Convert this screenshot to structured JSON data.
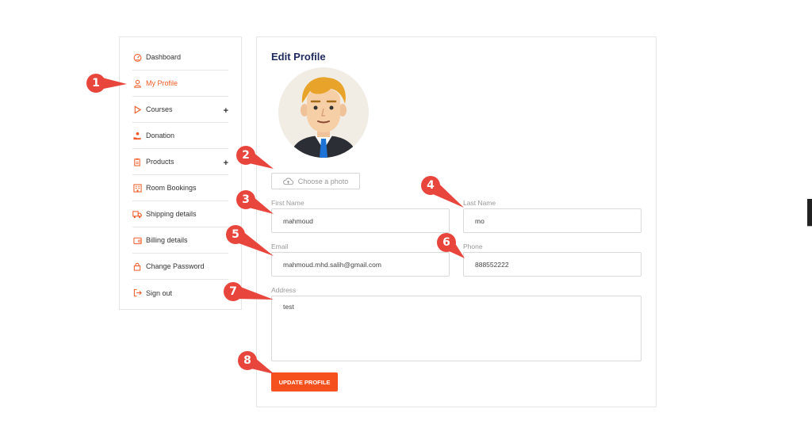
{
  "sidebar": {
    "items": [
      {
        "label": "Dashboard",
        "icon": "dashboard-icon"
      },
      {
        "label": "My Profile",
        "icon": "user-icon",
        "active": true
      },
      {
        "label": "Courses",
        "icon": "play-icon",
        "expandable": "+"
      },
      {
        "label": "Donation",
        "icon": "donation-hand-icon"
      },
      {
        "label": "Products",
        "icon": "clipboard-icon",
        "expandable": "+"
      },
      {
        "label": "Room Bookings",
        "icon": "building-icon"
      },
      {
        "label": "Shipping details",
        "icon": "truck-icon"
      },
      {
        "label": "Billing details",
        "icon": "wallet-icon"
      },
      {
        "label": "Change Password",
        "icon": "lock-icon"
      },
      {
        "label": "Sign out",
        "icon": "sign-out-icon"
      }
    ]
  },
  "profile": {
    "title": "Edit Profile",
    "photo_button": "Choose a photo",
    "fields": {
      "first_name": {
        "label": "First Name",
        "value": "mahmoud"
      },
      "last_name": {
        "label": "Last Name",
        "value": "mo"
      },
      "email": {
        "label": "Email",
        "value": "mahmoud.mhd.salih@gmail.com"
      },
      "phone": {
        "label": "Phone",
        "value": "888552222"
      },
      "address": {
        "label": "Address",
        "value": "test"
      }
    },
    "update_button": "UPDATE PROFILE"
  },
  "annotations": [
    "1",
    "2",
    "3",
    "4",
    "5",
    "6",
    "7",
    "8"
  ],
  "colors": {
    "accent": "#f15a24",
    "button": "#f4511e",
    "title": "#1f2a5c",
    "marker": "#e8453c"
  }
}
